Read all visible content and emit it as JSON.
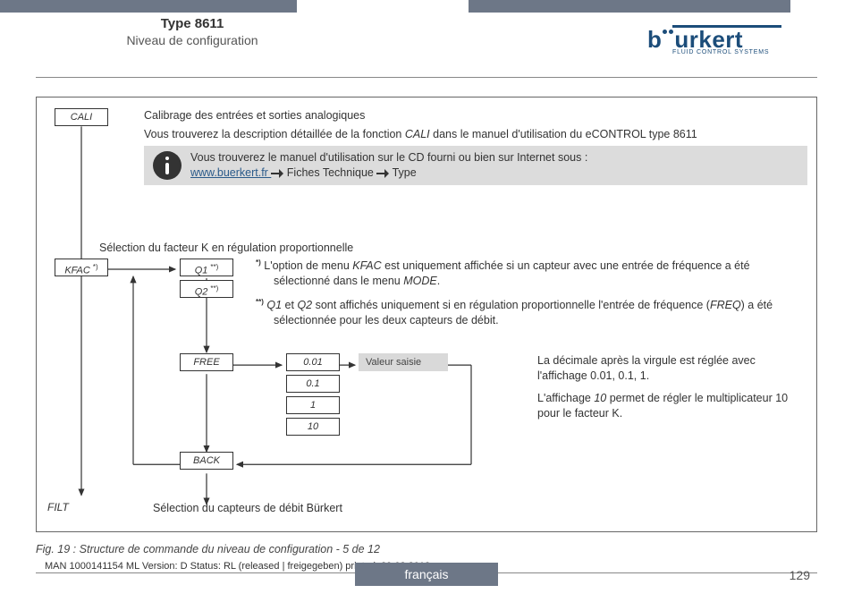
{
  "header": {
    "title": "Type 8611",
    "subtitle": "Niveau de configuration"
  },
  "logo": {
    "name": "burkert",
    "tagline": "FLUID CONTROL SYSTEMS"
  },
  "intro": {
    "line1": "Calibrage des entrées et sorties analogiques",
    "line2_a": "Vous trouverez la description détaillée de la fonction ",
    "line2_b": "CALI",
    "line2_c": " dans le manuel d'utilisation du eCONTROL type 8611"
  },
  "note": {
    "line1": "Vous trouverez le manuel d'utilisation sur le CD fourni ou bien sur Internet sous :",
    "link": "www.buerkert.fr ",
    "line2a": "Fiches Technique",
    "line2b": "Type"
  },
  "selection1": "Sélection du facteur K en régulation proportionnelle",
  "starnotes": {
    "n1_mark": "*)",
    "n1_a": "L'option de menu ",
    "n1_b": "KFAC",
    "n1_c": " est uniquement affichée si un capteur avec une entrée de fréquence a été sélectionné dans le menu ",
    "n1_d": "MODE",
    "n1_e": ".",
    "n2_mark": "**)",
    "n2_a": "Q1",
    "n2_b": " et ",
    "n2_c": "Q2",
    "n2_d": " sont affichés uniquement si en régulation proportionnelle l'entrée de fréquence (",
    "n2_e": "FREQ",
    "n2_f": ") a été sélectionnée pour les deux capteurs de débit."
  },
  "decnote": {
    "p1": "La décimale après la virgule est réglée avec l'affichage 0.01, 0.1, 1.",
    "p2_a": "L'affichage ",
    "p2_b": "10",
    "p2_c": " permet de régler le multiplicateur 10 pour le facteur K."
  },
  "valeur_saisie": "Valeur saisie",
  "selection2": "Sélection du capteurs de débit Bürkert",
  "filt": "FILT",
  "boxes": {
    "cali": "CALI",
    "kfac": "KFAC ",
    "kfac_sup": "*)",
    "q1": "Q1 ",
    "q1_sup": "**)",
    "q2": "Q2 ",
    "q2_sup": "**)",
    "free": "FREE",
    "back": "BACK",
    "d001": "0.01",
    "d01": "0.1",
    "d1": "1",
    "d10": "10"
  },
  "caption": "Fig. 19 :  Structure de commande du niveau de configuration - 5 de 12",
  "footmeta": "MAN  1000141154  ML  Version: D Status: RL (released | freigegeben)  printed: 29.08.2013",
  "langtab": "français",
  "pagenum": "129"
}
